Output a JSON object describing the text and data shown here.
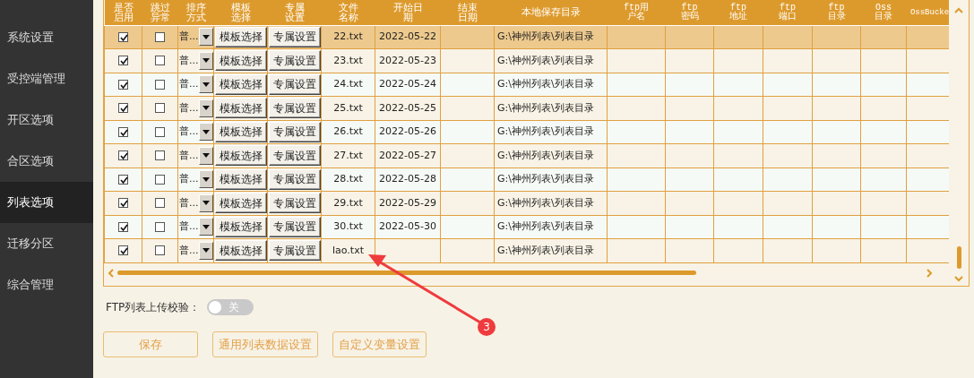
{
  "sidebar": {
    "items": [
      {
        "label": "系统设置",
        "selected": false
      },
      {
        "label": "受控端管理",
        "selected": false
      },
      {
        "label": "开区选项",
        "selected": false
      },
      {
        "label": "合区选项",
        "selected": false
      },
      {
        "label": "列表选项",
        "selected": true
      },
      {
        "label": "迁移分区",
        "selected": false
      },
      {
        "label": "综合管理",
        "selected": false
      }
    ]
  },
  "table": {
    "columns": [
      {
        "label": "是否启用",
        "kind": "text"
      },
      {
        "label": "跳过异常",
        "kind": "text"
      },
      {
        "label": "排序方式",
        "kind": "text"
      },
      {
        "label": "模板选择",
        "kind": "text"
      },
      {
        "label": "专属设置",
        "kind": "text"
      },
      {
        "label": "文件名称",
        "kind": "text"
      },
      {
        "label": "开始日期",
        "kind": "text"
      },
      {
        "label": "结束日期",
        "kind": "text"
      },
      {
        "label": "本地保存目录",
        "kind": "text"
      },
      {
        "label": "ftp用户名",
        "kind": "mono"
      },
      {
        "label": "ftp\n密码",
        "kind": "mono"
      },
      {
        "label": "ftp\n地址",
        "kind": "mono"
      },
      {
        "label": "ftp\n端口",
        "kind": "mono"
      },
      {
        "label": "ftp\n目录",
        "kind": "mono"
      },
      {
        "label": "Oss\n目录",
        "kind": "mono"
      },
      {
        "label": "OssBucke",
        "kind": "mono"
      }
    ],
    "rows": [
      {
        "selected": true,
        "enabled": true,
        "skip_error": false,
        "sort": "普...",
        "template": "模板选择",
        "custom": "专属设置",
        "file": "22.txt",
        "start": "2022-05-22",
        "dir": "G:\\神州列表\\列表目录"
      },
      {
        "selected": false,
        "enabled": true,
        "skip_error": false,
        "sort": "普...",
        "template": "模板选择",
        "custom": "专属设置",
        "file": "23.txt",
        "start": "2022-05-23",
        "dir": "G:\\神州列表\\列表目录"
      },
      {
        "selected": false,
        "enabled": true,
        "skip_error": false,
        "sort": "普...",
        "template": "模板选择",
        "custom": "专属设置",
        "file": "24.txt",
        "start": "2022-05-24",
        "dir": "G:\\神州列表\\列表目录"
      },
      {
        "selected": false,
        "enabled": true,
        "skip_error": false,
        "sort": "普...",
        "template": "模板选择",
        "custom": "专属设置",
        "file": "25.txt",
        "start": "2022-05-25",
        "dir": "G:\\神州列表\\列表目录"
      },
      {
        "selected": false,
        "enabled": true,
        "skip_error": false,
        "sort": "普...",
        "template": "模板选择",
        "custom": "专属设置",
        "file": "26.txt",
        "start": "2022-05-26",
        "dir": "G:\\神州列表\\列表目录"
      },
      {
        "selected": false,
        "enabled": true,
        "skip_error": false,
        "sort": "普...",
        "template": "模板选择",
        "custom": "专属设置",
        "file": "27.txt",
        "start": "2022-05-27",
        "dir": "G:\\神州列表\\列表目录"
      },
      {
        "selected": false,
        "enabled": true,
        "skip_error": false,
        "sort": "普...",
        "template": "模板选择",
        "custom": "专属设置",
        "file": "28.txt",
        "start": "2022-05-28",
        "dir": "G:\\神州列表\\列表目录"
      },
      {
        "selected": false,
        "enabled": true,
        "skip_error": false,
        "sort": "普...",
        "template": "模板选择",
        "custom": "专属设置",
        "file": "29.txt",
        "start": "2022-05-29",
        "dir": "G:\\神州列表\\列表目录"
      },
      {
        "selected": false,
        "enabled": true,
        "skip_error": false,
        "sort": "普...",
        "template": "模板选择",
        "custom": "专属设置",
        "file": "30.txt",
        "start": "2022-05-30",
        "dir": "G:\\神州列表\\列表目录"
      },
      {
        "selected": false,
        "enabled": true,
        "skip_error": false,
        "sort": "普...",
        "template": "模板选择",
        "custom": "专属设置",
        "file": "lao.txt",
        "dir": "G:\\神州列表\\列表目录"
      }
    ]
  },
  "ftp_check": {
    "label": "FTP列表上传校验：",
    "on": false,
    "state_text": "关"
  },
  "buttons": [
    "保存",
    "通用列表数据设置",
    "自定义变量设置"
  ],
  "annotation": {
    "badge": "3"
  }
}
